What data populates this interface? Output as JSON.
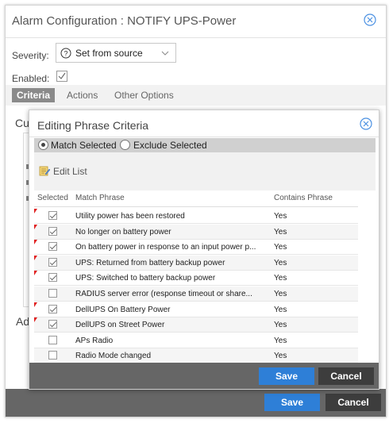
{
  "outer": {
    "title": "Alarm Configuration : NOTIFY UPS-Power",
    "severity_label": "Severity:",
    "severity_value": "Set from source",
    "enabled_label": "Enabled:",
    "tabs": [
      {
        "label": "Criteria",
        "active": true
      },
      {
        "label": "Actions",
        "active": false
      },
      {
        "label": "Other Options",
        "active": false
      }
    ],
    "bg_section_top": "Cu",
    "bg_section_bottom": "Ad",
    "save_label": "Save",
    "cancel_label": "Cancel"
  },
  "inner": {
    "title": "Editing Phrase Criteria",
    "match_selected_label": "Match Selected",
    "exclude_selected_label": "Exclude Selected",
    "edit_list_label": "Edit List",
    "columns": {
      "selected": "Selected",
      "match_phrase": "Match Phrase",
      "contains_phrase": "Contains Phrase"
    },
    "rows": [
      {
        "phrase": "Utility power has been restored",
        "contains": "Yes",
        "checked": true,
        "flag": true
      },
      {
        "phrase": "No longer on battery power",
        "contains": "Yes",
        "checked": true,
        "flag": true
      },
      {
        "phrase": "On battery power in response to an input power p...",
        "contains": "Yes",
        "checked": true,
        "flag": true
      },
      {
        "phrase": "UPS: Returned from battery backup power",
        "contains": "Yes",
        "checked": true,
        "flag": true
      },
      {
        "phrase": "UPS: Switched to battery backup power",
        "contains": "Yes",
        "checked": true,
        "flag": true
      },
      {
        "phrase": "RADIUS server error (response timeout or share...",
        "contains": "Yes",
        "checked": false,
        "flag": false
      },
      {
        "phrase": "DellUPS On Battery Power",
        "contains": "Yes",
        "checked": true,
        "flag": true
      },
      {
        "phrase": "DellUPS on Street Power",
        "contains": "Yes",
        "checked": true,
        "flag": true
      },
      {
        "phrase": "APs Radio",
        "contains": "Yes",
        "checked": false,
        "flag": false
      },
      {
        "phrase": "Radio Mode changed",
        "contains": "Yes",
        "checked": false,
        "flag": false
      }
    ],
    "save_label": "Save",
    "cancel_label": "Cancel"
  },
  "colors": {
    "accent": "#2e7fd7",
    "footer": "#666666",
    "cancel": "#3d3d3d",
    "flag": "#e02020"
  }
}
